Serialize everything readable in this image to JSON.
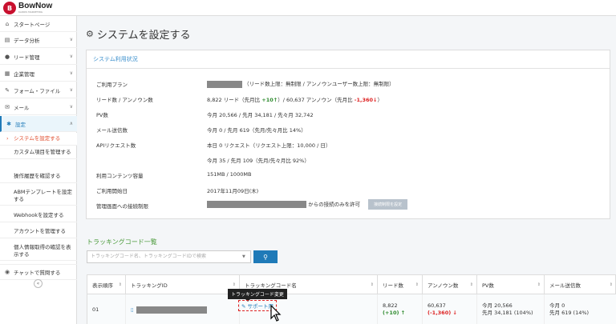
{
  "app": {
    "logo_letter": "B",
    "name": "BowNow",
    "sub": "KAIROS MARKETING"
  },
  "sidebar": {
    "items": [
      {
        "label": "スタートページ",
        "icon": "home-icon",
        "glyph": "⌂"
      },
      {
        "label": "データ分析",
        "icon": "chart-icon",
        "glyph": "▤",
        "chev": "∨"
      },
      {
        "label": "リード管理",
        "icon": "user-icon",
        "glyph": "●",
        "chev": "∨"
      },
      {
        "label": "企業管理",
        "icon": "building-icon",
        "glyph": "▦",
        "chev": "∨"
      },
      {
        "label": "フォーム・ファイル",
        "icon": "edit-icon",
        "glyph": "✎",
        "chev": "∨"
      },
      {
        "label": "メール",
        "icon": "mail-icon",
        "glyph": "✉",
        "chev": "∨"
      },
      {
        "label": "設定",
        "icon": "gear-icon",
        "glyph": "✱",
        "chev": "∧"
      }
    ],
    "subitems": [
      "システムを設定する",
      "カスタム項目を管理する",
      "操作履歴を確認する",
      "ABMテンプレートを設定する",
      "Webhookを設定する",
      "アカウントを管理する",
      "個人情報取得の確認を表示する"
    ],
    "chat": "チャットで質問する",
    "collapse": "«"
  },
  "page": {
    "title": "システムを設定する"
  },
  "status": {
    "heading": "システム利用状況",
    "rows": [
      {
        "label": "ご利用プラン",
        "value": "（リード数上限：無制限 / アンノウンユーザー数上限：無制限）"
      },
      {
        "label": "リード数 / アンノウン数",
        "value_a": "8,822 リード（先月比 ",
        "lead_diff": "+10↑",
        "value_b": "）/ 60,637 アンノウン（先月比 ",
        "unk_diff": "-1,360↓",
        "value_c": "）"
      },
      {
        "label": "PV数",
        "value": "今月 20,566 / 先月 34,181 / 先々月 32,742"
      },
      {
        "label": "メール送信数",
        "value": "今月 0 / 先月 619（先月/先々月比 14%）"
      },
      {
        "label": "APIリクエスト数",
        "value": "本日 0 リクエスト（リクエスト上限：10,000 / 日）",
        "value2": "今月 35 / 先月 109（先月/先々月比 92%）"
      },
      {
        "label": "利用コンテンツ容量",
        "value": "151MB / 1000MB"
      },
      {
        "label": "ご利用開始日",
        "value": "2017年11月09日(木)"
      },
      {
        "label": "管理画面への接続制限",
        "value": "からの接続のみを許可",
        "button": "接続制限を設定"
      }
    ]
  },
  "tracking": {
    "title": "トラッキングコード一覧",
    "search_placeholder": "トラッキングコード名、トラッキングコードIDで検索",
    "search_btn": "⚲",
    "columns": [
      "表示順序",
      "トラッキングID",
      "トラッキングコード名",
      "リード数",
      "アンノウン数",
      "PV数",
      "メール送信数"
    ],
    "row": {
      "order": "01",
      "name": "サポート用",
      "leads": "8,822",
      "leads_diff": "(+10) ↑",
      "unknown": "60,637",
      "unknown_diff": "(-1,360) ↓",
      "pv1": "今月 20,566",
      "pv2": "先月 34,181 (104%)",
      "mail1": "今月 0",
      "mail2": "先月 619 (14%)"
    },
    "tooltip": "トラッキングコード変更"
  }
}
